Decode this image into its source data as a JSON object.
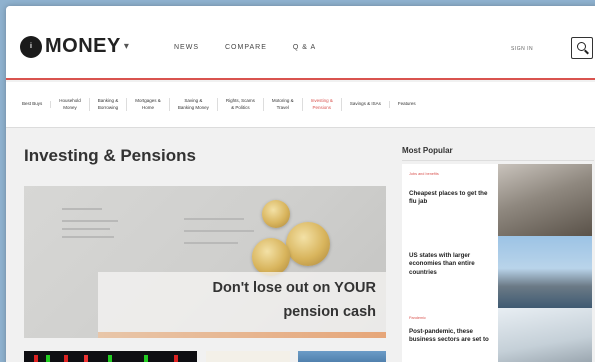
{
  "header": {
    "logo_badge": "i",
    "logo_text": "MONEY",
    "logo_caret": "▾",
    "nav": [
      "NEWS",
      "COMPARE",
      "Q & A"
    ],
    "sign_in": "SIGN IN",
    "search_icon": "search-icon"
  },
  "categories": [
    {
      "label": "Best Buys",
      "active": false
    },
    {
      "label": "Household\nMoney",
      "active": false
    },
    {
      "label": "Banking &\nBorrowing",
      "active": false
    },
    {
      "label": "Mortgages &\nHome",
      "active": false
    },
    {
      "label": "Saving &\nBanking Money",
      "active": false
    },
    {
      "label": "Rights, Scams\n& Politics",
      "active": false
    },
    {
      "label": "Motoring &\nTravel",
      "active": false
    },
    {
      "label": "Investing &\nPensions",
      "active": true
    },
    {
      "label": "Savings & ISAs",
      "active": false
    },
    {
      "label": "Features",
      "active": false
    }
  ],
  "main": {
    "page_title": "Investing & Pensions",
    "hero_line1": "Don't lose out on YOUR",
    "hero_line2": "pension cash"
  },
  "sidebar": {
    "title": "Most Popular",
    "cards": [
      {
        "kicker": "Jobs and benefits",
        "title": "Cheapest places to get the flu jab"
      },
      {
        "kicker": "",
        "title": "US states with larger economies than entire countries"
      },
      {
        "kicker": "Pandemic",
        "title": "Post-pandemic, these business sectors are set to"
      }
    ]
  },
  "colors": {
    "accent": "#d9534f",
    "background": "#8fb2cf",
    "page": "#f1f1f1"
  }
}
